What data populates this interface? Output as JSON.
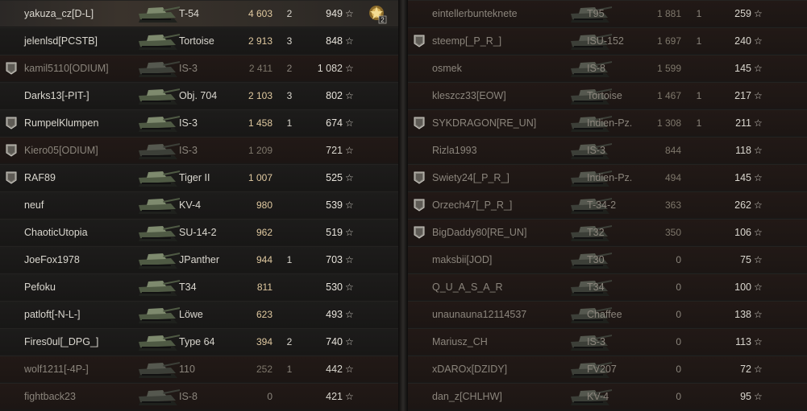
{
  "left_team": [
    {
      "player": "yakuza_cz[D-L]",
      "vehicle": "T-54",
      "damage": "4 603",
      "kills": "2",
      "xp": "949",
      "badge": "",
      "dead": false,
      "highlight": true,
      "medal": "2"
    },
    {
      "player": "jelenlsd[PCSTB]",
      "vehicle": "Tortoise",
      "damage": "2 913",
      "kills": "3",
      "xp": "848",
      "badge": "",
      "dead": false,
      "highlight": false,
      "medal": ""
    },
    {
      "player": "kamil5110[ODIUM]",
      "vehicle": "IS-3",
      "damage": "2 411",
      "kills": "2",
      "xp": "1 082",
      "badge": "2",
      "dead": true,
      "highlight": false,
      "medal": ""
    },
    {
      "player": "Darks13[-PIT-]",
      "vehicle": "Obj. 704",
      "damage": "2 103",
      "kills": "3",
      "xp": "802",
      "badge": "",
      "dead": false,
      "highlight": false,
      "medal": ""
    },
    {
      "player": "RumpelKlumpen",
      "vehicle": "IS-3",
      "damage": "1 458",
      "kills": "1",
      "xp": "674",
      "badge": "1",
      "dead": false,
      "highlight": false,
      "medal": ""
    },
    {
      "player": "Kiero05[ODIUM]",
      "vehicle": "IS-3",
      "damage": "1 209",
      "kills": "",
      "xp": "721",
      "badge": "2",
      "dead": true,
      "highlight": false,
      "medal": ""
    },
    {
      "player": "RAF89",
      "vehicle": "Tiger II",
      "damage": "1 007",
      "kills": "",
      "xp": "525",
      "badge": "1",
      "dead": false,
      "highlight": false,
      "medal": ""
    },
    {
      "player": "neuf",
      "vehicle": "KV-4",
      "damage": "980",
      "kills": "",
      "xp": "539",
      "badge": "",
      "dead": false,
      "highlight": false,
      "medal": ""
    },
    {
      "player": "ChaoticUtopia",
      "vehicle": "SU-14-2",
      "damage": "962",
      "kills": "",
      "xp": "519",
      "badge": "",
      "dead": false,
      "highlight": false,
      "medal": ""
    },
    {
      "player": "JoeFox1978",
      "vehicle": "JPanther",
      "damage": "944",
      "kills": "1",
      "xp": "703",
      "badge": "",
      "dead": false,
      "highlight": false,
      "medal": ""
    },
    {
      "player": "Pefoku",
      "vehicle": "T34",
      "damage": "811",
      "kills": "",
      "xp": "530",
      "badge": "",
      "dead": false,
      "highlight": false,
      "medal": ""
    },
    {
      "player": "patloft[-N-L-]",
      "vehicle": "Löwe",
      "damage": "623",
      "kills": "",
      "xp": "493",
      "badge": "",
      "dead": false,
      "highlight": false,
      "medal": ""
    },
    {
      "player": "Fires0ul[_DPG_]",
      "vehicle": "Type 64",
      "damage": "394",
      "kills": "2",
      "xp": "740",
      "badge": "",
      "dead": false,
      "highlight": false,
      "medal": ""
    },
    {
      "player": "wolf1211[-4P-]",
      "vehicle": "110",
      "damage": "252",
      "kills": "1",
      "xp": "442",
      "badge": "",
      "dead": true,
      "highlight": false,
      "medal": ""
    },
    {
      "player": "fightback23",
      "vehicle": "IS-8",
      "damage": "0",
      "kills": "",
      "xp": "421",
      "badge": "",
      "dead": true,
      "highlight": false,
      "medal": ""
    }
  ],
  "right_team": [
    {
      "player": "eintellerbunteknete",
      "vehicle": "T95",
      "damage": "1 881",
      "kills": "1",
      "xp": "259",
      "badge": "",
      "dead": true
    },
    {
      "player": "steemp[_P_R_]",
      "vehicle": "ISU-152",
      "damage": "1 697",
      "kills": "1",
      "xp": "240",
      "badge": "2",
      "dead": true
    },
    {
      "player": "osmek",
      "vehicle": "IS-8",
      "damage": "1 599",
      "kills": "",
      "xp": "145",
      "badge": "",
      "dead": true
    },
    {
      "player": "kleszcz33[EOW]",
      "vehicle": "Tortoise",
      "damage": "1 467",
      "kills": "1",
      "xp": "217",
      "badge": "",
      "dead": true
    },
    {
      "player": "SYKDRAGON[RE_UN]",
      "vehicle": "Indien-Pz.",
      "damage": "1 308",
      "kills": "1",
      "xp": "211",
      "badge": "1",
      "dead": true
    },
    {
      "player": "Rizla1993",
      "vehicle": "IS-3",
      "damage": "844",
      "kills": "",
      "xp": "118",
      "badge": "",
      "dead": true
    },
    {
      "player": "Swiety24[_P_R_]",
      "vehicle": "Indien-Pz.",
      "damage": "494",
      "kills": "",
      "xp": "145",
      "badge": "2",
      "dead": true
    },
    {
      "player": "Orzech47[_P_R_]",
      "vehicle": "T-34-2",
      "damage": "363",
      "kills": "",
      "xp": "262",
      "badge": "2",
      "dead": true
    },
    {
      "player": "BigDaddy80[RE_UN]",
      "vehicle": "T32",
      "damage": "350",
      "kills": "",
      "xp": "106",
      "badge": "1",
      "dead": true
    },
    {
      "player": "maksbii[JOD]",
      "vehicle": "T30",
      "damage": "0",
      "kills": "",
      "xp": "75",
      "badge": "",
      "dead": true
    },
    {
      "player": "Q_U_A_S_A_R",
      "vehicle": "T34",
      "damage": "0",
      "kills": "",
      "xp": "100",
      "badge": "",
      "dead": true
    },
    {
      "player": "unaunauna12114537",
      "vehicle": "Chaffee",
      "damage": "0",
      "kills": "",
      "xp": "138",
      "badge": "",
      "dead": true
    },
    {
      "player": "Mariusz_CH",
      "vehicle": "IS-3",
      "damage": "0",
      "kills": "",
      "xp": "113",
      "badge": "",
      "dead": true
    },
    {
      "player": "xDAROx[DZIDY]",
      "vehicle": "FV207",
      "damage": "0",
      "kills": "",
      "xp": "72",
      "badge": "",
      "dead": true
    },
    {
      "player": "dan_z[CHLHW]",
      "vehicle": "KV-4",
      "damage": "0",
      "kills": "",
      "xp": "95",
      "badge": "",
      "dead": true
    }
  ],
  "icons": {
    "xp_star": "star-icon",
    "badge": "platoon-badge-icon",
    "tank": "tank-silhouette-icon",
    "medal": "achievement-medal-icon"
  },
  "colors": {
    "name": "#dad7cf",
    "dead_name": "#8b857c",
    "damage": "#e0c9a0",
    "player_row": "#3a332c"
  }
}
